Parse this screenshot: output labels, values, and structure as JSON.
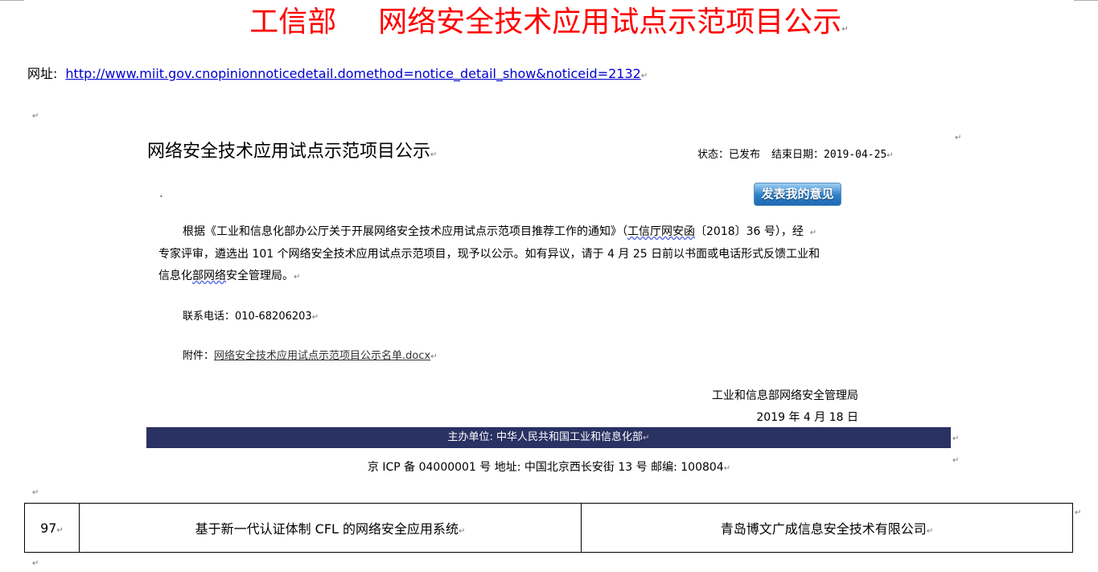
{
  "header": {
    "title_left": "工信部",
    "title_right": "网络安全技术应用试点示范项目公示"
  },
  "url": {
    "label": "网址:",
    "link": "http://www.miit.gov.cnopinionnoticedetail.domethod=notice_detail_show&noticeid=2132"
  },
  "notice": {
    "title": "网络安全技术应用试点示范项目公示",
    "status": "状态：已发布",
    "end_date": "结束日期：2019-04-25",
    "comment_button": "发表我的意见",
    "para_lines": [
      "根据《工业和信息化部办公厅关于开展网络安全技术应用试点示范项目推荐工作的通知》（",
      "工信厅网安函",
      "〔2018〕36 号），经",
      "专家评审，遴选出 101 个网络安全技术应用试点示范项目，现予以公示。如有异议，请于 4 月 25 日前以书面或电话形式反馈工业和",
      "信息化",
      "部网络",
      "安全管理局。"
    ],
    "contact": "联系电话：010-68206203",
    "attachment_label": "附件：",
    "attachment_file": "网络安全技术应用试点示范项目公示名单.docx",
    "signature_org": "工业和信息部网络安全管理局",
    "signature_date": "2019 年 4 月 18 日"
  },
  "footer": {
    "host": "主办单位: 中华人民共和国工业和信息化部",
    "icp": "京 ICP 备  04000001 号  地址:  中国北京西长安街 13 号  邮编: 100804"
  },
  "table": {
    "rows": [
      {
        "no": "97",
        "project": "基于新一代认证体制 CFL 的网络安全应用系统",
        "company": "青岛博文广成信息安全技术有限公司"
      }
    ]
  },
  "marks": {
    "paragraph": "↵"
  },
  "colors": {
    "title": "#ff0000",
    "link": "#0000cc",
    "footer_bar": "#2a3163",
    "button": "#2d7fc8"
  }
}
